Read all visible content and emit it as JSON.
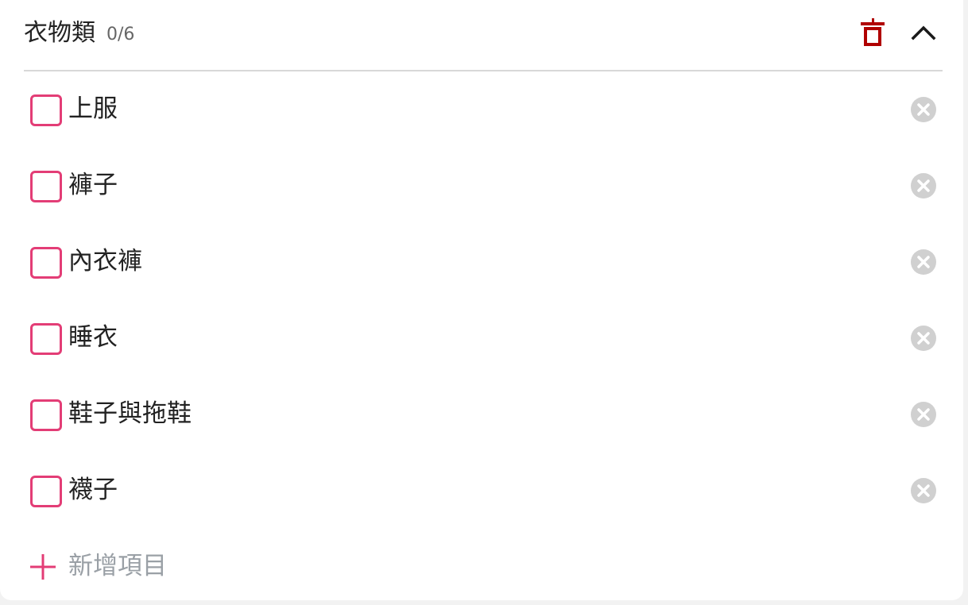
{
  "section": {
    "title": "衣物類",
    "count": "0/6",
    "trash_color": "#b00000",
    "collapse_icon": "chevron-up-icon"
  },
  "items": [
    {
      "label": "上服",
      "checked": false
    },
    {
      "label": "褲子",
      "checked": false
    },
    {
      "label": "內衣褲",
      "checked": false
    },
    {
      "label": "睡衣",
      "checked": false
    },
    {
      "label": "鞋子與拖鞋",
      "checked": false
    },
    {
      "label": "襪子",
      "checked": false
    }
  ],
  "add_item": {
    "label": "新增項目"
  },
  "colors": {
    "accent": "#e33d76",
    "remove_icon": "#d0d0d0",
    "divider": "#d8d8d8"
  }
}
